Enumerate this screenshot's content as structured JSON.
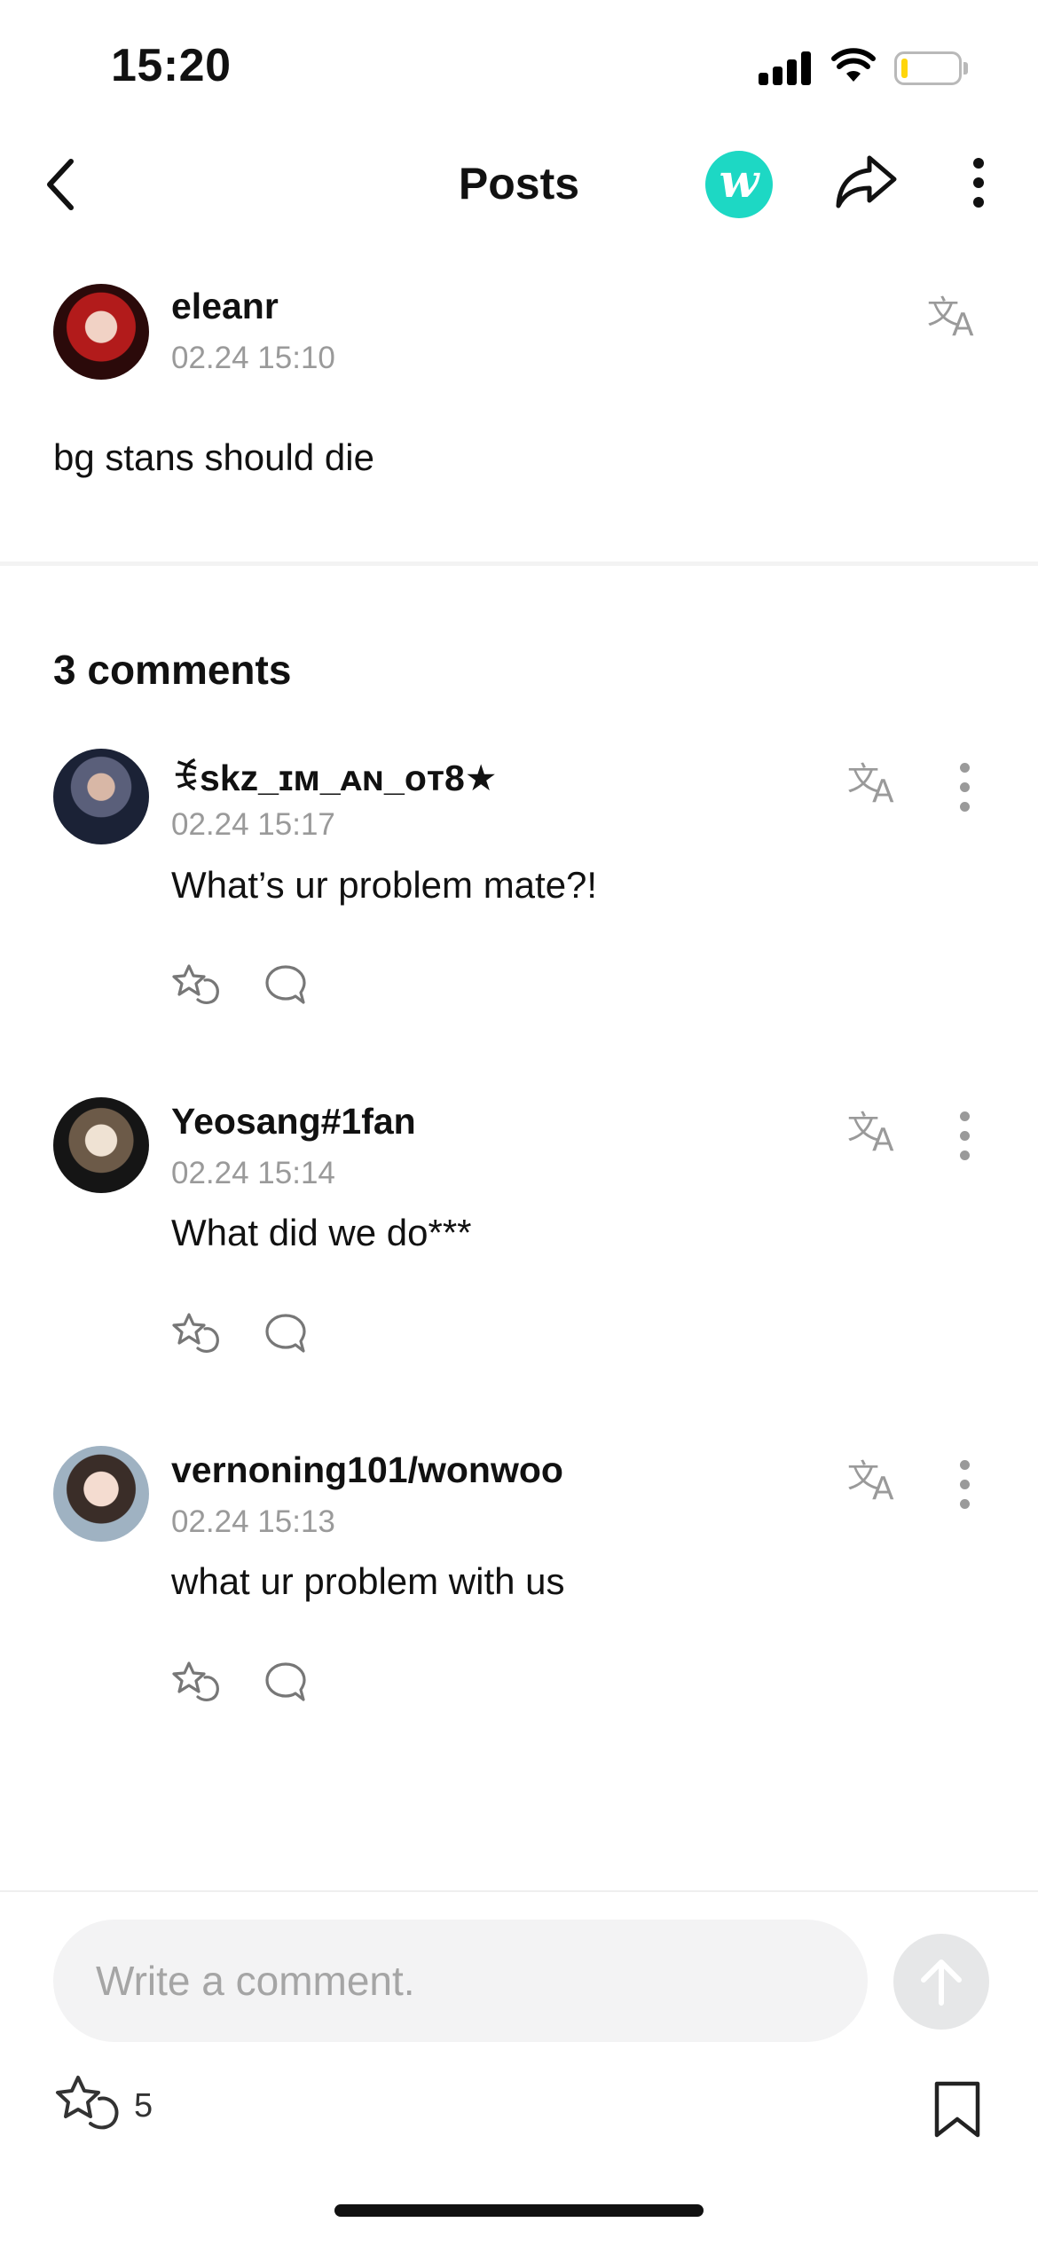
{
  "status_bar": {
    "time": "15:20"
  },
  "nav": {
    "title": "Posts",
    "brand_letter": "w"
  },
  "post": {
    "author": "eleanr",
    "date": "02.24 15:10",
    "text": "bg stans should die"
  },
  "comments_header": "3 comments",
  "comments": [
    {
      "author": "ꉂskz_ɪᴍ_ᴀɴ_ᴏᴛ8★",
      "date": "02.24 15:17",
      "text": "What’s ur problem mate?!"
    },
    {
      "author": "Yeosang#1fan",
      "date": "02.24 15:14",
      "text": "What did we do***"
    },
    {
      "author": "vernoning101/wonwoo",
      "date": "02.24 15:13",
      "text": "what ur problem with us"
    }
  ],
  "composer": {
    "placeholder": "Write a comment."
  },
  "footer": {
    "like_count": "5"
  },
  "icons": {
    "back": "chevron-left-icon",
    "share": "share-arrow-icon",
    "more": "more-vertical-icon",
    "translate": "translate-icon",
    "like": "star-hand-like-icon",
    "reply": "speech-bubble-icon",
    "send": "arrow-up-icon",
    "bookmark": "bookmark-icon"
  },
  "colors": {
    "brand": "#1dd8c4",
    "meta_gray": "#9a9a9a",
    "input_bg": "#f3f3f4"
  }
}
